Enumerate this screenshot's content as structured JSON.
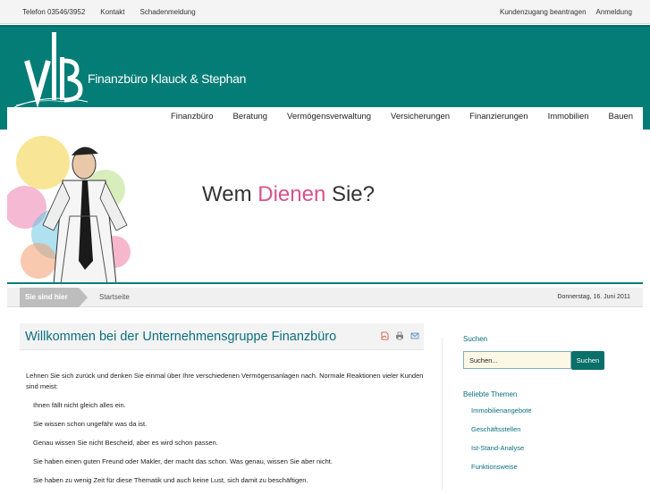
{
  "topbar": {
    "phone": "Telefon 03546/3952",
    "contact": "Kontakt",
    "claim": "Schadenmeldung",
    "customer_access": "Kundenzugang beantragen",
    "login": "Anmeldung"
  },
  "header": {
    "brand": "Finanzbüro Klauck & Stephan",
    "logo_text": "VIB",
    "brand_color": "#047d76"
  },
  "nav": {
    "items": [
      {
        "label": "Finanzbüro"
      },
      {
        "label": "Beratung"
      },
      {
        "label": "Vermögensverwaltung"
      },
      {
        "label": "Versicherungen"
      },
      {
        "label": "Finanzierungen"
      },
      {
        "label": "Immobilien"
      },
      {
        "label": "Bauen"
      }
    ]
  },
  "hero": {
    "slogan_pre": "Wem ",
    "slogan_hl": "Dienen",
    "slogan_post": " Sie?",
    "highlight_color": "#d6538a"
  },
  "breadcrumb": {
    "label": "Sie sind hier",
    "page": "Startseite",
    "date": "Donnerstag, 16. Juni 2011"
  },
  "article": {
    "title": "Willkommen bei der Unternehmensgruppe Finanzbüro",
    "icons": [
      "pdf-icon",
      "print-icon",
      "email-icon"
    ],
    "intro": "Lehnen Sie sich zurück und denken Sie einmal über Ihre verschiedenen Vermögensanlagen nach. Normale Reaktionen vieler Kunden sind meist:",
    "items": [
      "Ihnen fällt nicht gleich alles ein.",
      "Sie wissen schon ungefähr was da ist.",
      "Genau wissen Sie nicht Bescheid, aber es wird schon passen.",
      "Sie haben einen guten Freund oder Makler, der macht das schon. Was genau, wissen Sie aber nicht.",
      "Sie haben zu wenig Zeit für diese Thematik und auch keine Lust, sich damit zu beschäftigen."
    ]
  },
  "sidebar": {
    "search_title": "Suchen",
    "search_placeholder": "Suchen...",
    "search_button": "Suchen",
    "topics_title": "Beliebte Themen",
    "topics": [
      "Immobilienangebote",
      "Geschäftsstellen",
      "Ist-Stand-Analyse",
      "Funktionsweise"
    ]
  }
}
